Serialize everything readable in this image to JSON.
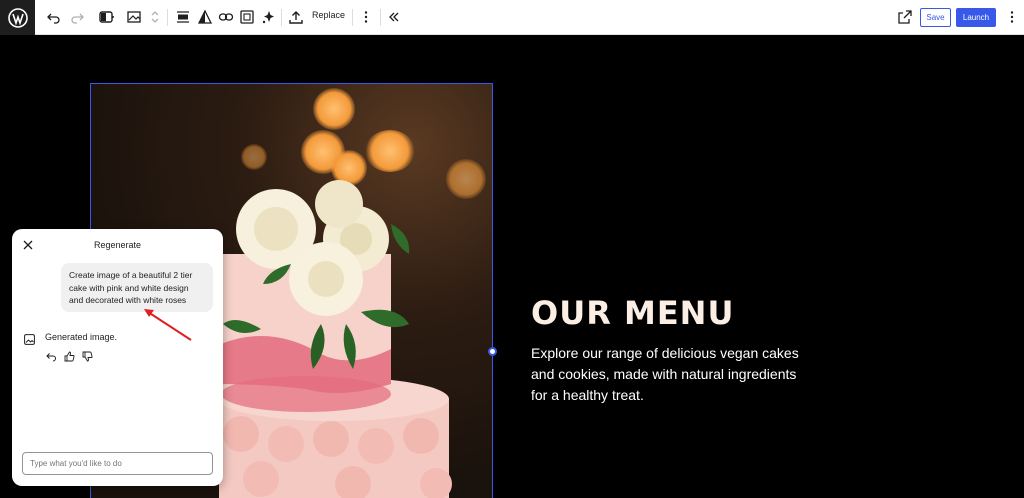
{
  "toolbar": {
    "replace_label": "Replace",
    "save_label": "Save",
    "launch_label": "Launch",
    "accent": "#3858e9"
  },
  "hero": {
    "title": "OUR MENU",
    "description": "Explore our range of delicious vegan cakes and cookies, made with natural ingredients for a healthy treat."
  },
  "panel": {
    "title": "Regenerate",
    "prompt": "Create image of a beautiful 2 tier cake with pink and white design and decorated with white roses",
    "response": "Generated image.",
    "input_placeholder": "Type what you'd like to do"
  }
}
